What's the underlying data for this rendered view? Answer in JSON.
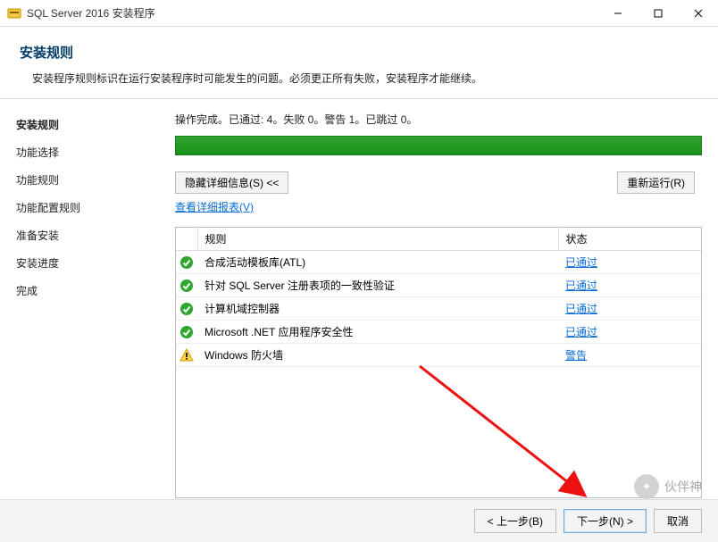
{
  "titlebar": {
    "title": "SQL Server 2016 安装程序"
  },
  "header": {
    "title": "安装规则",
    "desc": "安装程序规则标识在运行安装程序时可能发生的问题。必须更正所有失败，安装程序才能继续。"
  },
  "sidebar": {
    "steps": [
      {
        "label": "安装规则",
        "active": true
      },
      {
        "label": "功能选择",
        "active": false
      },
      {
        "label": "功能规则",
        "active": false
      },
      {
        "label": "功能配置规则",
        "active": false
      },
      {
        "label": "准备安装",
        "active": false
      },
      {
        "label": "安装进度",
        "active": false
      },
      {
        "label": "完成",
        "active": false
      }
    ]
  },
  "content": {
    "status_line": "操作完成。已通过: 4。失败 0。警告 1。已跳过 0。",
    "hide_details_btn": "隐藏详细信息(S) <<",
    "rerun_btn": "重新运行(R)",
    "view_report_link": "查看详细报表(V)",
    "table": {
      "col_rule": "规则",
      "col_status": "状态",
      "rows": [
        {
          "rule": "合成活动模板库(ATL)",
          "status": "已通过",
          "ok": true
        },
        {
          "rule": "针对 SQL Server 注册表项的一致性验证",
          "status": "已通过",
          "ok": true
        },
        {
          "rule": "计算机域控制器",
          "status": "已通过",
          "ok": true
        },
        {
          "rule": "Microsoft .NET 应用程序安全性",
          "status": "已通过",
          "ok": true
        },
        {
          "rule": "Windows 防火墙",
          "status": "警告",
          "ok": false
        }
      ]
    }
  },
  "footer": {
    "back": "< 上一步(B)",
    "next": "下一步(N) >",
    "cancel": "取消"
  },
  "watermark": {
    "text": "伙伴神"
  }
}
